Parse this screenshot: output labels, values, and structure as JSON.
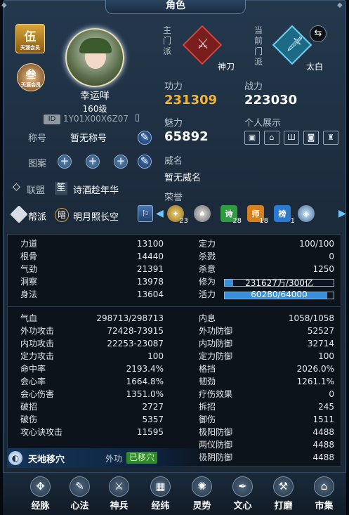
{
  "window": {
    "title": "角色"
  },
  "character": {
    "rank_badge": "伍",
    "rank_badge_sub": "天涯会员",
    "badge2": "叁",
    "badge2_sub": "天涯会员",
    "name": "幸运咩",
    "level": "160级",
    "id_label": "ID",
    "id_value": "1Y01X00X6Z07",
    "title_label": "称号",
    "title_value": "暂无称号",
    "pattern_label": "图案",
    "alliance_label": "联盟",
    "alliance_icon": "笙",
    "alliance_name": "诗酒趁年华",
    "gang_label": "帮派",
    "gang_icon": "暗",
    "gang_name": "明月照长空"
  },
  "sect": {
    "main_label": "主门派",
    "main_name": "神刀",
    "current_label": "当前门派",
    "current_name": "太白"
  },
  "scores": {
    "gongli_label": "功力",
    "gongli_value": "231309",
    "zhanli_label": "战力",
    "zhanli_value": "223030",
    "meili_label": "魅力",
    "meili_value": "65892",
    "showcase_label": "个人展示",
    "weiming_label": "威名",
    "weiming_value": "暂无威名",
    "honor_label": "荣誉"
  },
  "honors": [
    {
      "icon": "wing-icon",
      "count": "23"
    },
    {
      "icon": "hat-icon",
      "count": ""
    },
    {
      "icon": "诗",
      "count": "28"
    },
    {
      "icon": "师",
      "count": "18"
    },
    {
      "icon": "榜",
      "count": "1"
    },
    {
      "icon": "crystal-icon",
      "count": ""
    }
  ],
  "stats_left_top": [
    {
      "k": "力道",
      "v": "13100"
    },
    {
      "k": "根骨",
      "v": "14440"
    },
    {
      "k": "气劲",
      "v": "21391"
    },
    {
      "k": "洞察",
      "v": "13978"
    },
    {
      "k": "身法",
      "v": "13604"
    }
  ],
  "stats_right_top": [
    {
      "k": "定力",
      "v": "100/100"
    },
    {
      "k": "杀戮",
      "v": "0"
    },
    {
      "k": "杀意",
      "v": "1250"
    }
  ],
  "xiuwei": {
    "k": "修为",
    "v": "231627万/300亿",
    "ratio": 0.08
  },
  "huoli": {
    "k": "活力",
    "v": "60280/64000",
    "ratio": 0.94
  },
  "stats_left": [
    {
      "k": "气血",
      "v": "298713/298713"
    },
    {
      "k": "外功攻击",
      "v": "72428-73915"
    },
    {
      "k": "内功攻击",
      "v": "22253-23087"
    },
    {
      "k": "定力攻击",
      "v": "100"
    },
    {
      "k": "命中率",
      "v": "2193.4%"
    },
    {
      "k": "会心率",
      "v": "1664.8%"
    },
    {
      "k": "会心伤害",
      "v": "1351.0%"
    },
    {
      "k": "破招",
      "v": "2727"
    },
    {
      "k": "破伤",
      "v": "5357"
    },
    {
      "k": "攻心诀攻击",
      "v": "11595"
    }
  ],
  "stats_right": [
    {
      "k": "内息",
      "v": "1058/1058"
    },
    {
      "k": "外功防御",
      "v": "52527"
    },
    {
      "k": "内功防御",
      "v": "32714"
    },
    {
      "k": "定力防御",
      "v": "100"
    },
    {
      "k": "格挡",
      "v": "2026.0%"
    },
    {
      "k": "韧劲",
      "v": "1261.1%"
    },
    {
      "k": "疗伤效果",
      "v": "0"
    },
    {
      "k": "拆招",
      "v": "245"
    },
    {
      "k": "御伤",
      "v": "1511"
    },
    {
      "k": "极阳防御",
      "v": "4488"
    },
    {
      "k": "两仪防御",
      "v": "4488"
    },
    {
      "k": "极阴防御",
      "v": "4488"
    }
  ],
  "skill": {
    "name": "天地移穴",
    "type": "外功",
    "status": "已移穴"
  },
  "nav": [
    {
      "label": "经脉",
      "icon": "dots-icon",
      "glyph": "✥"
    },
    {
      "label": "心法",
      "icon": "book-icon",
      "glyph": "✎"
    },
    {
      "label": "神兵",
      "icon": "weapon-icon",
      "glyph": "⚔"
    },
    {
      "label": "经纬",
      "icon": "grid-icon",
      "glyph": "▦"
    },
    {
      "label": "灵势",
      "icon": "swirl-icon",
      "glyph": "✺"
    },
    {
      "label": "文心",
      "icon": "brush-icon",
      "glyph": "✒"
    },
    {
      "label": "打磨",
      "icon": "hammer-icon",
      "glyph": "⚒"
    },
    {
      "label": "市集",
      "icon": "shop-icon",
      "glyph": "⌂"
    }
  ],
  "colors": {
    "gongli": "#f0b43a",
    "accent": "#3a8fd9",
    "skill_status": "#2f8a2a"
  }
}
